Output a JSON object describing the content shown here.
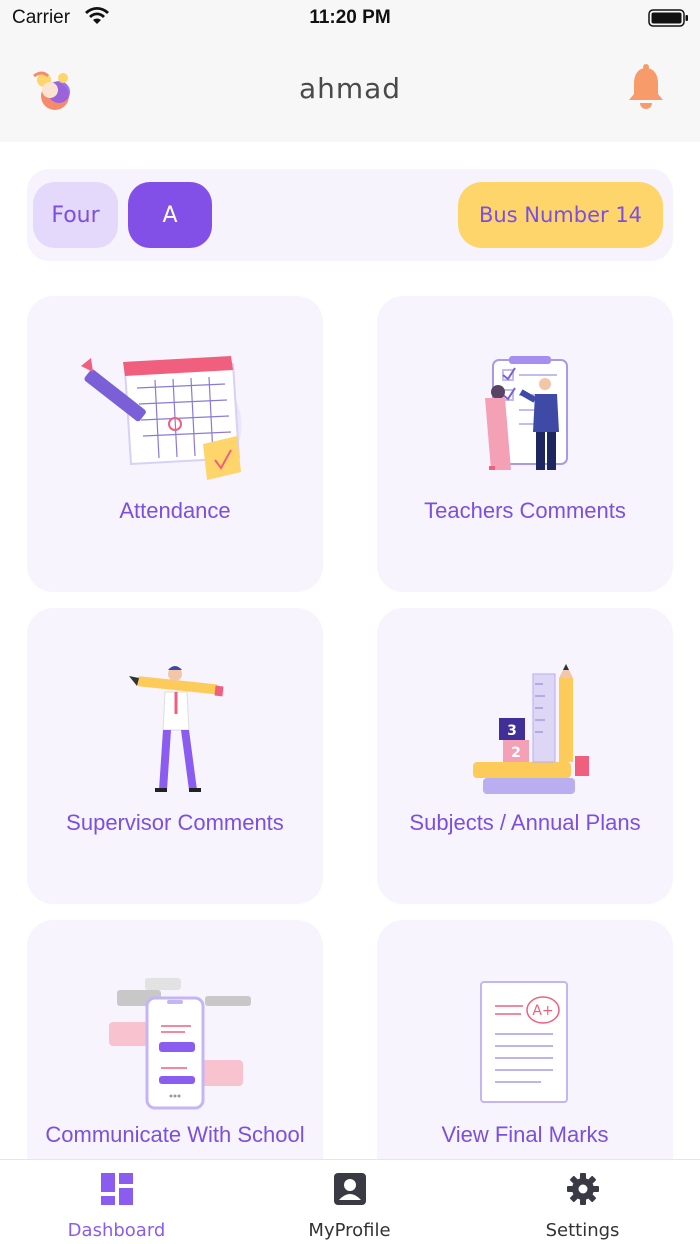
{
  "status_bar": {
    "carrier": "Carrier",
    "time": "11:20 PM"
  },
  "header": {
    "title": "ahmad",
    "avatar_icon": "child-avatar-icon",
    "bell_icon": "bell-icon",
    "bell_color": "#f79b6a"
  },
  "class_info": {
    "grade": "Four",
    "section": "A",
    "bus": "Bus Number 14"
  },
  "cards": [
    {
      "label": "Attendance",
      "icon": "calendar-illustration"
    },
    {
      "label": "Teachers Comments",
      "icon": "checklist-illustration"
    },
    {
      "label": "Supervisor Comments",
      "icon": "pencil-man-illustration"
    },
    {
      "label": "Subjects / Annual Plans",
      "icon": "books-illustration"
    },
    {
      "label": "Communicate With School",
      "icon": "chat-phone-illustration"
    },
    {
      "label": "View Final Marks",
      "icon": "marks-sheet-illustration"
    }
  ],
  "tabs": [
    {
      "label": "Dashboard",
      "icon": "dashboard-icon",
      "active": true
    },
    {
      "label": "MyProfile",
      "icon": "profile-icon",
      "active": false
    },
    {
      "label": "Settings",
      "icon": "gear-icon",
      "active": false
    }
  ],
  "colors": {
    "accent": "#8250e6",
    "card_bg": "#f7f4fd",
    "bus_pill": "#fdd56b",
    "grade_pill": "#e4d9fa"
  }
}
